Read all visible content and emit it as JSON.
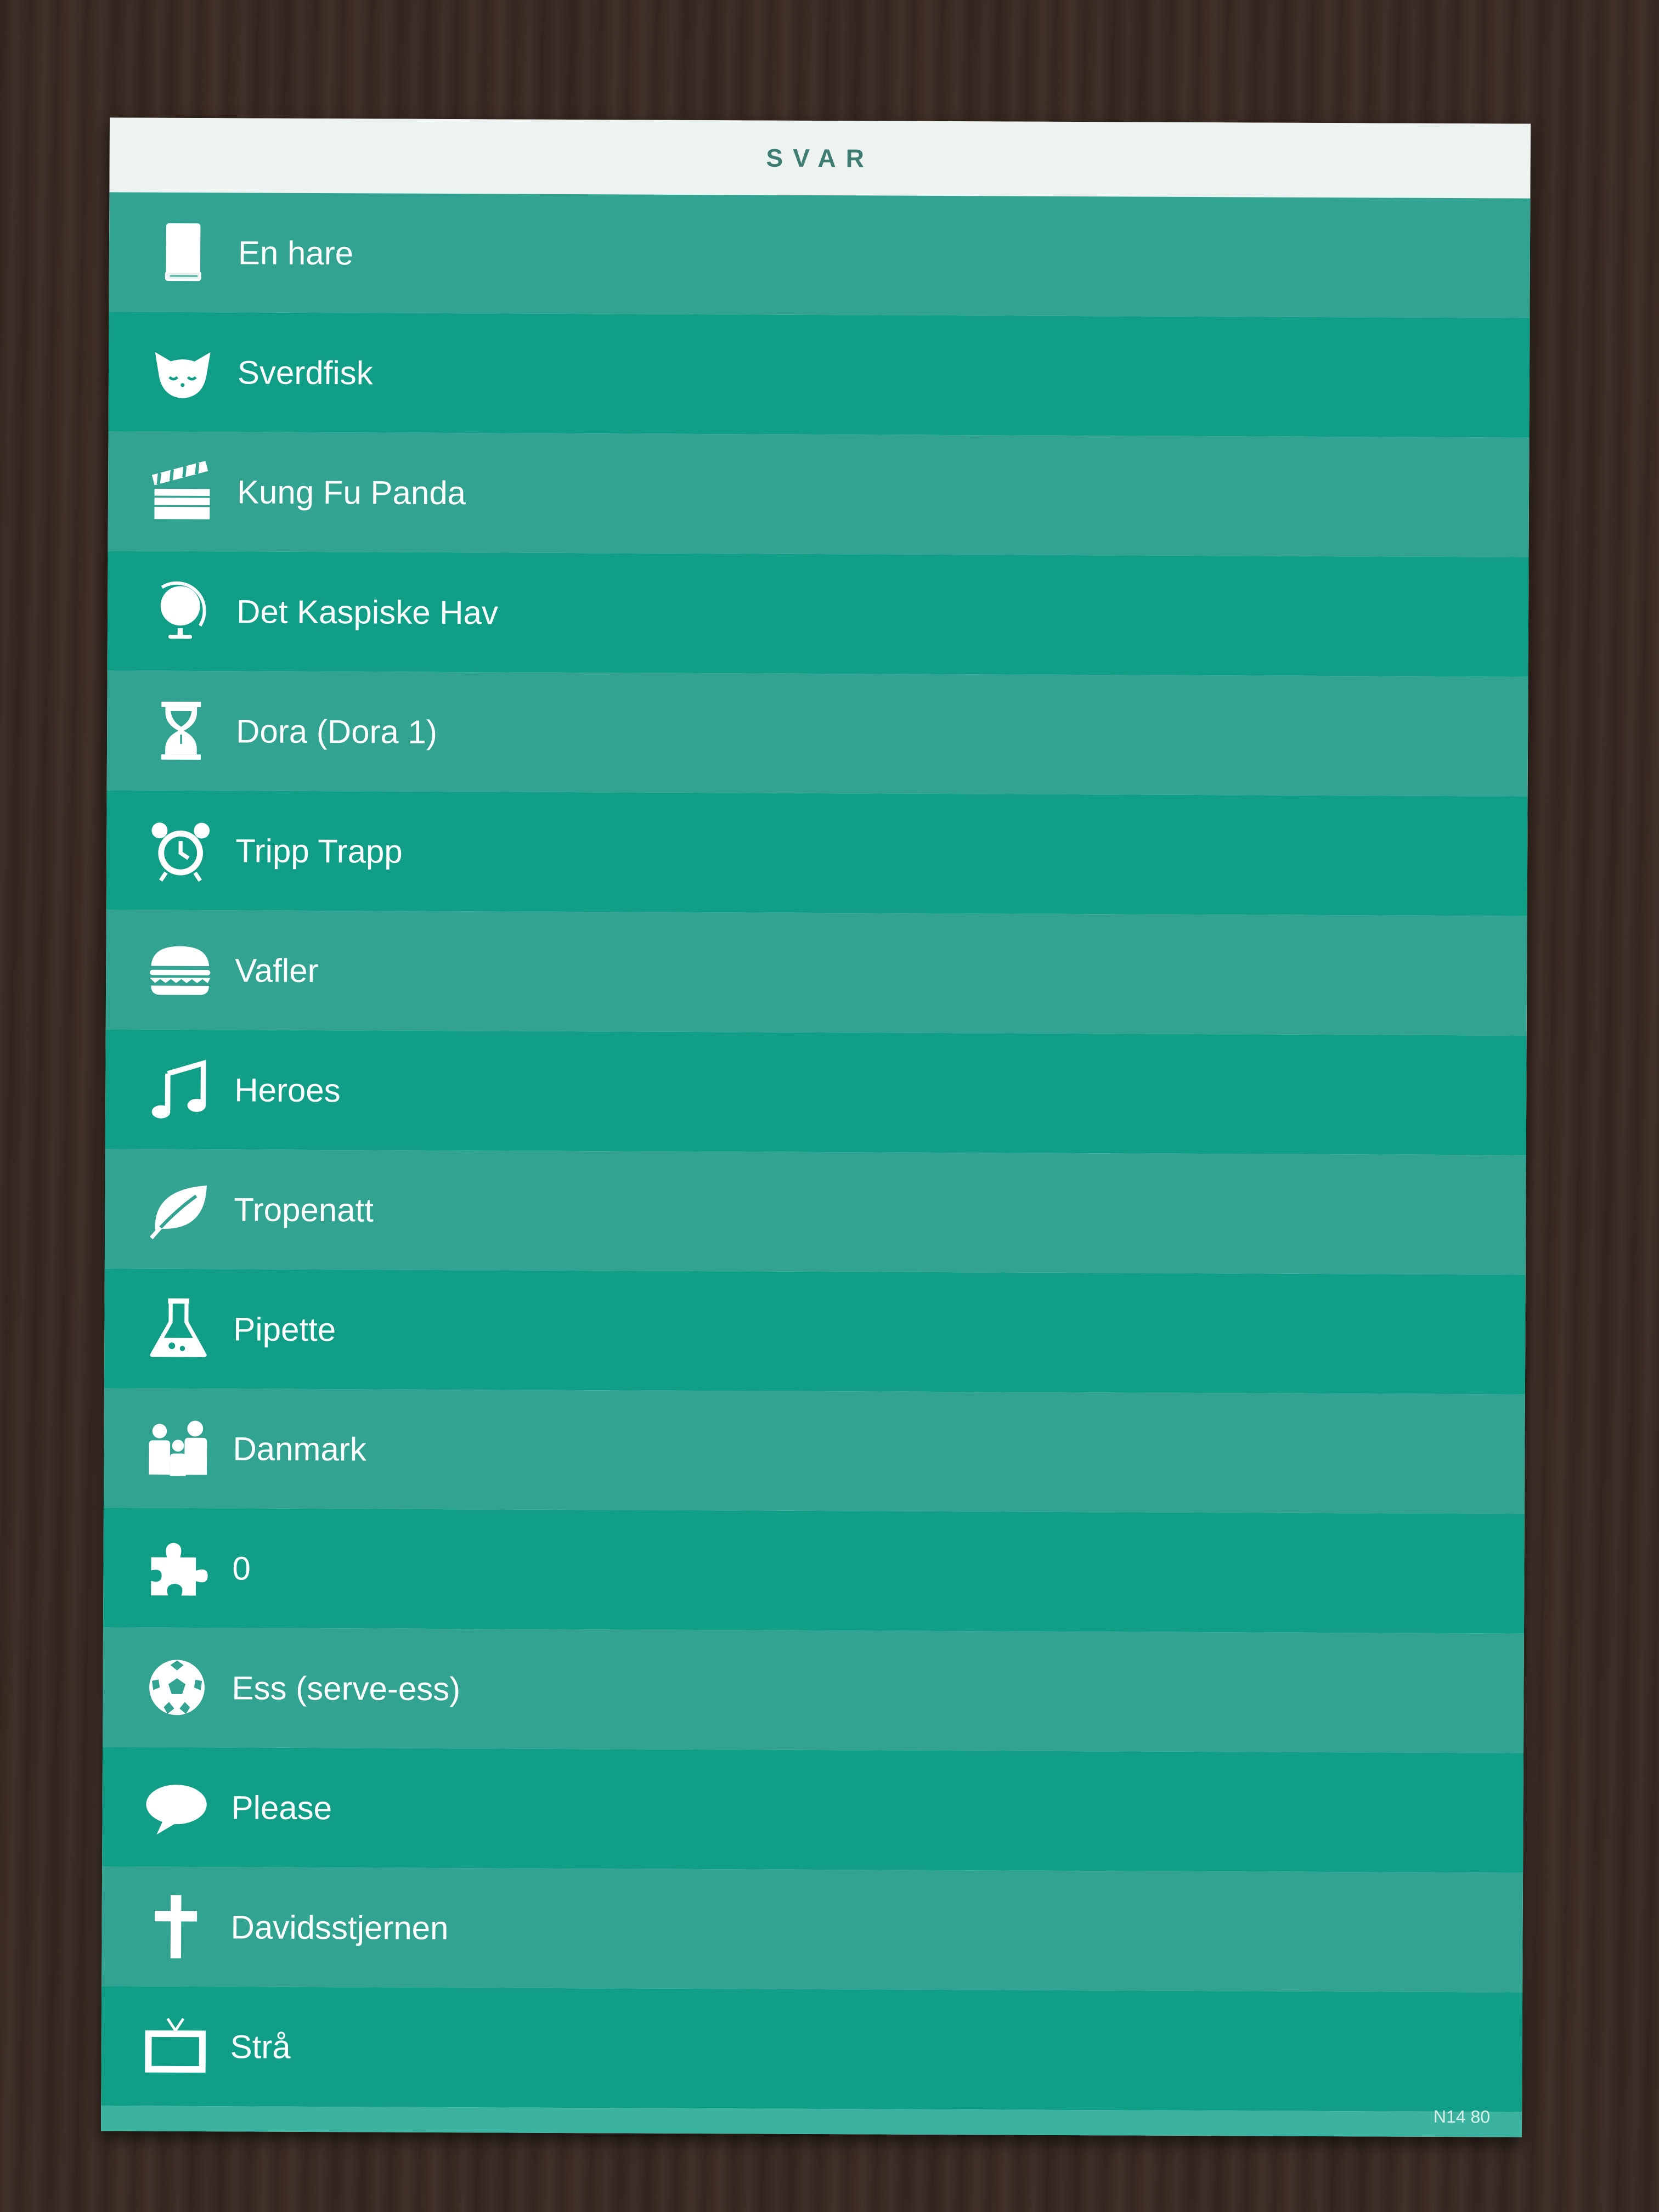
{
  "card": {
    "title": "SVAR",
    "footer_code": "N14  80",
    "colors": {
      "stripe_light": "#32a391",
      "stripe_dark": "#109e86",
      "header_bg": "#edf3f1",
      "header_text": "#3f7d72",
      "table": "#3b2b23"
    }
  },
  "answers": [
    {
      "icon": "book-icon",
      "text": "En hare"
    },
    {
      "icon": "cat-icon",
      "text": "Sverdfisk"
    },
    {
      "icon": "clapperboard-icon",
      "text": "Kung Fu Panda"
    },
    {
      "icon": "globe-icon",
      "text": "Det Kaspiske Hav"
    },
    {
      "icon": "hourglass-icon",
      "text": "Dora (Dora 1)"
    },
    {
      "icon": "alarm-clock-icon",
      "text": "Tripp Trapp"
    },
    {
      "icon": "burger-icon",
      "text": "Vafler"
    },
    {
      "icon": "music-note-icon",
      "text": "Heroes"
    },
    {
      "icon": "leaf-icon",
      "text": "Tropenatt"
    },
    {
      "icon": "flask-icon",
      "text": "Pipette"
    },
    {
      "icon": "family-icon",
      "text": "Danmark"
    },
    {
      "icon": "puzzle-icon",
      "text": "0"
    },
    {
      "icon": "football-icon",
      "text": "Ess (serve-ess)"
    },
    {
      "icon": "speech-bubble-icon",
      "text": "Please"
    },
    {
      "icon": "cross-icon",
      "text": "Davidsstjernen"
    },
    {
      "icon": "tv-icon",
      "text": "Strå"
    }
  ]
}
